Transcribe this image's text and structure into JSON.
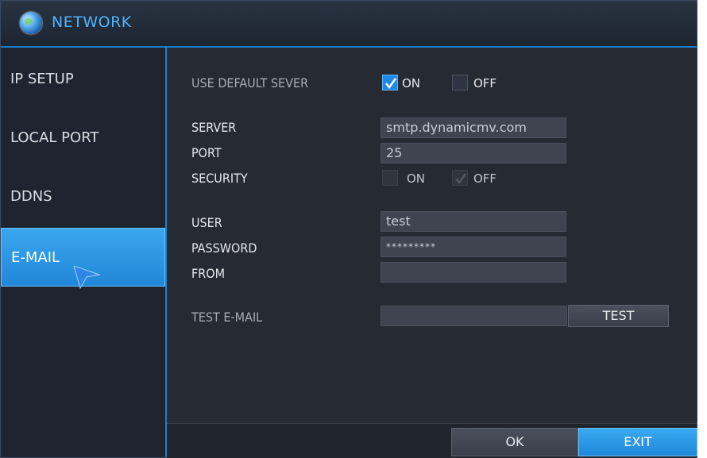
{
  "window": {
    "title": "NETWORK",
    "icon": "globe-icon"
  },
  "sidebar": {
    "items": [
      {
        "label": "IP SETUP",
        "active": false
      },
      {
        "label": "LOCAL PORT",
        "active": false
      },
      {
        "label": "DDNS",
        "active": false
      },
      {
        "label": "E-MAIL",
        "active": true
      }
    ]
  },
  "form": {
    "use_default_server": {
      "label": "USE DEFAULT SEVER",
      "on_label": "ON",
      "on_checked": true,
      "off_label": "OFF",
      "off_checked": false
    },
    "server": {
      "label": "SERVER",
      "value": "smtp.dynamicmv.com"
    },
    "port": {
      "label": "PORT",
      "value": "25"
    },
    "security": {
      "label": "SECURITY",
      "on_label": "ON",
      "on_checked": false,
      "off_label": "OFF",
      "off_checked": true,
      "disabled": true
    },
    "user": {
      "label": "USER",
      "value": "test"
    },
    "password": {
      "label": "PASSWORD",
      "value": "*********"
    },
    "from": {
      "label": "FROM",
      "value": ""
    },
    "test_email": {
      "label": "TEST E-MAIL",
      "value": "",
      "button": "TEST"
    }
  },
  "footer": {
    "ok_label": "OK",
    "exit_label": "EXIT"
  },
  "colors": {
    "accent": "#1e88e5",
    "background": "#262a33",
    "sidebar": "#1f2530",
    "title_text": "#4fb3ff"
  }
}
